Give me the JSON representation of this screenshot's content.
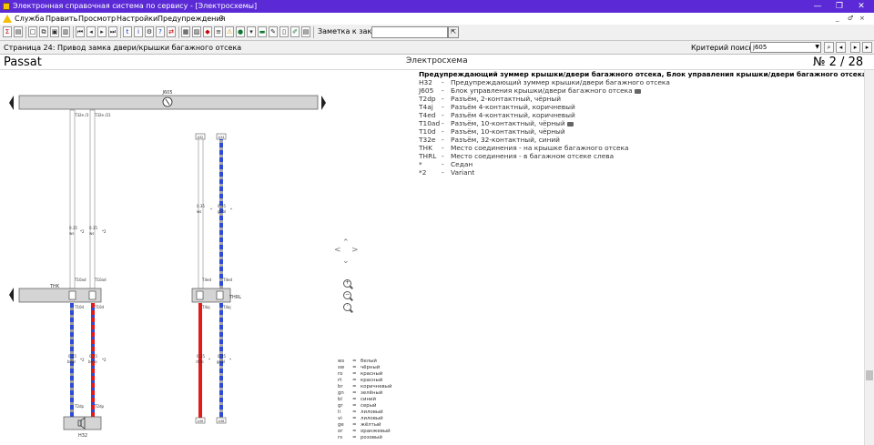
{
  "window": {
    "title": "Электронная справочная система по сервису - [Электросхемы]",
    "controls": [
      "—",
      "❐",
      "✕"
    ]
  },
  "menu": {
    "items": [
      "Служба",
      "Править",
      "Просмотр",
      "Настройки",
      "Предупреждения",
      "?"
    ],
    "mdi_controls": [
      "_",
      "♂",
      "×"
    ]
  },
  "toolbar": {
    "order_label": "Заметка к заказу:",
    "order_value": ""
  },
  "pagebar": {
    "breadcrumb": "Страница 24: Привод замка двери/крышки багажного отсека",
    "criteria_label": "Критерий поиска:",
    "criteria_value": "j605"
  },
  "document": {
    "model": "Passat",
    "kind": "Электросхема",
    "page": "№  2 / 28"
  },
  "legend": {
    "title": "Предупреждающий зуммер крышки/двери багажного отсека, Блок управления крышки/двери багажного отсека",
    "items": [
      {
        "code": "H32",
        "desc": "Предупреждающий зуммер крышки/двери багажного отсека",
        "camera": false
      },
      {
        "code": "J605",
        "desc": "Блок управления крышки/двери багажного отсека",
        "camera": true
      },
      {
        "code": "T2dp",
        "desc": "Разъём, 2-контактный, чёрный",
        "camera": false
      },
      {
        "code": "T4aj",
        "desc": "Разъём 4-контактный, коричневый",
        "camera": false
      },
      {
        "code": "T4ed",
        "desc": "Разъём 4-контактный, коричневый",
        "camera": false
      },
      {
        "code": "T10ad",
        "desc": "Разъём, 10-контактный, чёрный",
        "camera": true
      },
      {
        "code": "T10d",
        "desc": "Разъём, 10-контактный, чёрный",
        "camera": false
      },
      {
        "code": "T32e",
        "desc": "Разъём, 32-контактный, синий",
        "camera": false
      },
      {
        "code": "THK",
        "desc": "Место соединения - на крышке багажного отсека",
        "camera": false
      },
      {
        "code": "THRL",
        "desc": "Место соединения - в багажном отсеке слева",
        "camera": false
      },
      {
        "code": "*",
        "desc": "Седан",
        "camera": false
      },
      {
        "code": "*2",
        "desc": "Variant",
        "camera": false
      }
    ]
  },
  "color_key": [
    {
      "code": "ws",
      "name": "белый"
    },
    {
      "code": "sw",
      "name": "чёрный"
    },
    {
      "code": "ro",
      "name": "красный"
    },
    {
      "code": "rt",
      "name": "красный"
    },
    {
      "code": "br",
      "name": "коричневый"
    },
    {
      "code": "gn",
      "name": "зелёный"
    },
    {
      "code": "bl",
      "name": "синий"
    },
    {
      "code": "gr",
      "name": "серый"
    },
    {
      "code": "li",
      "name": "лиловый"
    },
    {
      "code": "vi",
      "name": "лиловый"
    },
    {
      "code": "ge",
      "name": "жёлтый"
    },
    {
      "code": "or",
      "name": "оранжевый"
    },
    {
      "code": "rs",
      "name": "розовый"
    }
  ],
  "diagram": {
    "top_bus_label": "J605",
    "top_bus_pins": [
      "T32e /3",
      "T32e /21"
    ],
    "upper_wires": [
      {
        "size": "0.35",
        "color": "ws",
        "note": "*2"
      },
      {
        "size": "0.35",
        "color": "ws",
        "note": "*2"
      }
    ],
    "right_top_labels": [
      "A32",
      "A34"
    ],
    "right_upper_wires": [
      {
        "size": "0.35",
        "color": "ws",
        "note": "*"
      },
      {
        "size": "0.35",
        "color": "gr/bl",
        "note": "*"
      }
    ],
    "junction_left": "THK",
    "junction_left_pins": [
      "T10ad",
      "T10ad"
    ],
    "junction_right": "THRL",
    "junction_right_pins": [
      "T4ed",
      "T4ed"
    ],
    "left_lower_pins": [
      "T10d",
      "T10d"
    ],
    "right_lower_pins": [
      "T4aj",
      "T4aj"
    ],
    "left_lower_wires": [
      {
        "size": "0.35",
        "color": "bl/gr",
        "note": "*2"
      },
      {
        "size": "0.35",
        "color": "br/ro",
        "note": "*2"
      }
    ],
    "right_lower_wires": [
      {
        "size": "0.35",
        "color": "rt/ro",
        "note": "*"
      },
      {
        "size": "0.35",
        "color": "gr/bl",
        "note": "*"
      }
    ],
    "buzzer_pins": [
      "T2dp",
      "T2dp"
    ],
    "buzzer_label": "H32",
    "bottom_right_labels": [
      "A36",
      "A38"
    ]
  }
}
